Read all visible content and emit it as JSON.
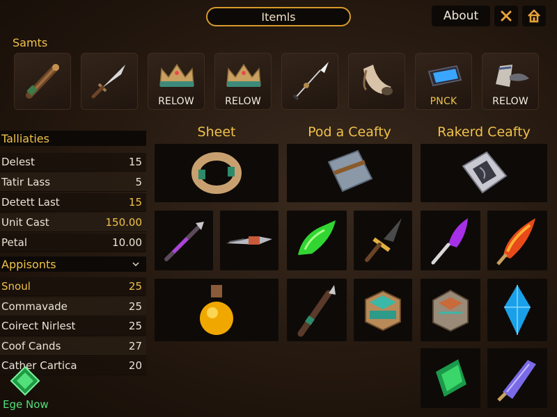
{
  "header": {
    "title": "Itemls",
    "about_label": "About",
    "close_icon": "close-icon",
    "home_icon": "home-icon"
  },
  "samts": {
    "label": "Samts",
    "items": [
      {
        "icon": "club-icon",
        "badge": ""
      },
      {
        "icon": "sword-icon",
        "badge": ""
      },
      {
        "icon": "crown-icon",
        "badge": "RELOW"
      },
      {
        "icon": "crown-icon",
        "badge": "RELOW"
      },
      {
        "icon": "spear-icon",
        "badge": ""
      },
      {
        "icon": "horn-icon",
        "badge": ""
      },
      {
        "icon": "blue-gem-icon",
        "badge": "PNCK"
      },
      {
        "icon": "scroll-icon",
        "badge": "RELOW"
      }
    ]
  },
  "stats": {
    "title": "Talliaties",
    "rows": [
      {
        "name": "Delest",
        "value": "15"
      },
      {
        "name": "Tatir Lass",
        "value": "5"
      },
      {
        "name": "Detett Last",
        "value": "15"
      },
      {
        "name": "Unit Cast",
        "value": "150.00"
      },
      {
        "name": "Petal",
        "value": "10.00"
      }
    ]
  },
  "appsonts": {
    "title": "Appisonts",
    "rows": [
      {
        "name": "Snoul",
        "value": "25"
      },
      {
        "name": "Commavade",
        "value": "25"
      },
      {
        "name": "Coirect Nirlest",
        "value": "25"
      },
      {
        "name": "Coof Cands",
        "value": "27"
      },
      {
        "name": "Cather Cartica",
        "value": "20"
      }
    ]
  },
  "cta": {
    "label": "Ege Now",
    "icon": "green-diamond-icon"
  },
  "categories": [
    {
      "title": "Sheet"
    },
    {
      "title": "Pod a Ceafty"
    },
    {
      "title": "Rakerd Ceafty"
    }
  ],
  "colors": {
    "accent_gold": "#f0c24a",
    "border_gold": "#d89a2c",
    "cta_green": "#52e07a",
    "panel_dark": "#0d0906"
  }
}
